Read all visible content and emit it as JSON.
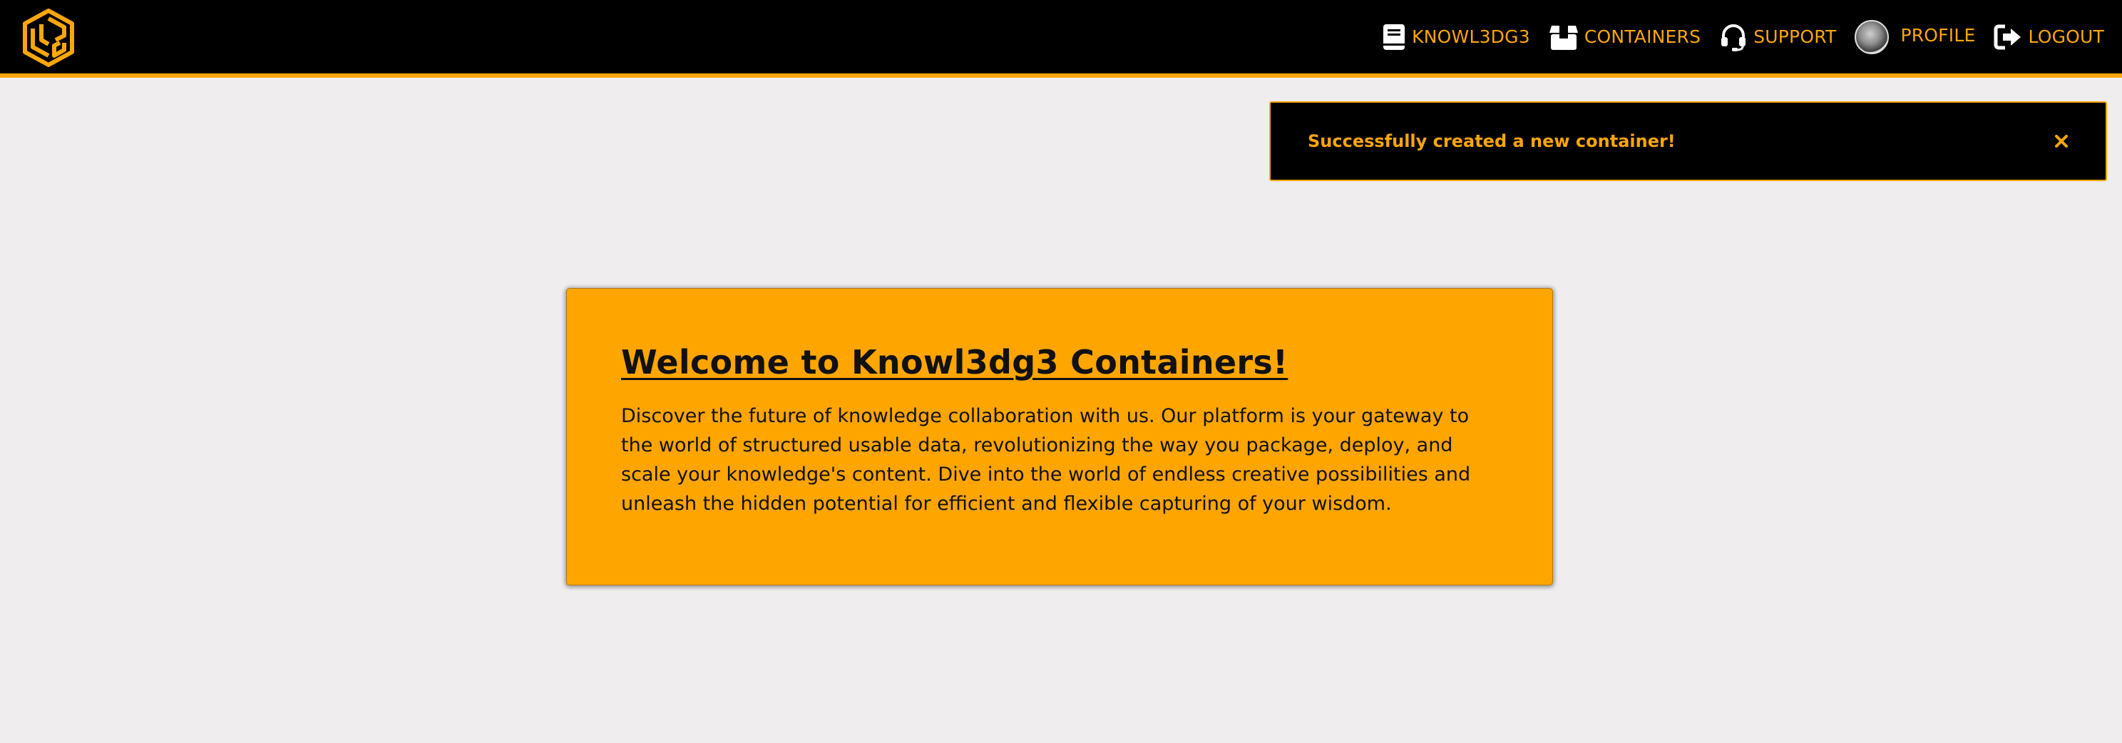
{
  "nav": {
    "logo_alt": "Knowl3dg3 logo",
    "items": [
      {
        "label": "KNOWL3DG3",
        "icon": "book-icon"
      },
      {
        "label": "CONTAINERS",
        "icon": "box-icon"
      },
      {
        "label": "SUPPORT",
        "icon": "headset-icon"
      },
      {
        "label": "PROFILE",
        "icon": "avatar"
      },
      {
        "label": "LOGOUT",
        "icon": "logout-icon"
      }
    ]
  },
  "toast": {
    "message": "Successfully created a new container!",
    "close_icon": "close-icon"
  },
  "welcome": {
    "title": "Welcome to Knowl3dg3 Containers!",
    "body": "Discover the future of knowledge collaboration with us. Our platform is your gateway to the world of structured usable data, revolutionizing the way you package, deploy, and scale your knowledge's content. Dive into the world of endless creative possibilities and unleash the hidden potential for efficient and flexible capturing of your wisdom."
  },
  "colors": {
    "accent": "#fba60a",
    "card_bg": "#fea500",
    "nav_bg": "#000000",
    "page_bg": "#efeded"
  }
}
